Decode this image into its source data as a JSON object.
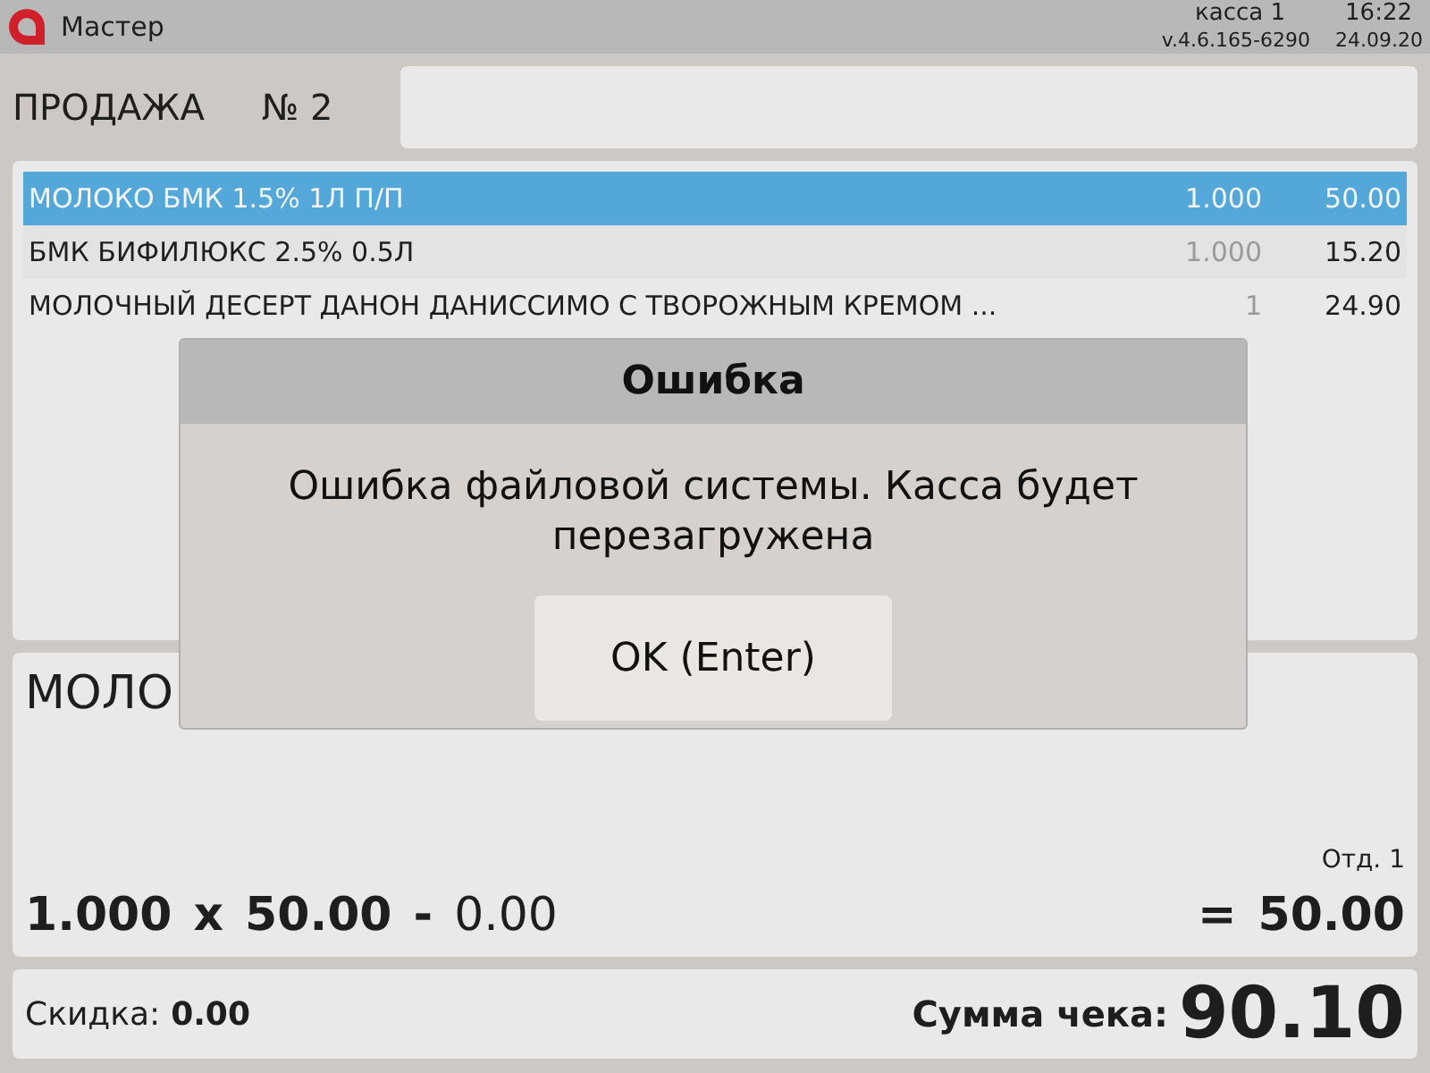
{
  "header": {
    "app_name": "Мастер",
    "register": "касса 1",
    "time": "16:22",
    "version": "v.4.6.165-6290",
    "date": "24.09.20"
  },
  "sale": {
    "title": "ПРОДАЖА",
    "number": "№ 2"
  },
  "rows": [
    {
      "name": "МОЛОКО БМК 1.5% 1Л П/П",
      "qty": "1.000",
      "sum": "50.00",
      "selected": true
    },
    {
      "name": "БМК БИФИЛЮКС 2.5% 0.5Л",
      "qty": "1.000",
      "sum": "15.20",
      "selected": false
    },
    {
      "name": "МОЛОЧНЫЙ ДЕСЕРТ ДАНОН ДАНИССИМО С ТВОРОЖНЫМ КРЕМОМ ...",
      "qty": "1",
      "sum": "24.90",
      "selected": false
    }
  ],
  "current_item": {
    "name": "МОЛО",
    "department": "Отд. 1",
    "qty": "1.000",
    "times": "x",
    "price": "50.00",
    "minus": "-",
    "discount": "0.00",
    "equals": "=",
    "total": "50.00"
  },
  "footer": {
    "discount_label": "Скидка:",
    "discount": "0.00",
    "total_label": "Сумма чека:",
    "total": "90.10"
  },
  "dialog": {
    "title": "Ошибка",
    "message": "Ошибка файловой системы. Касса будет перезагружена",
    "button": "OK (Enter)"
  }
}
